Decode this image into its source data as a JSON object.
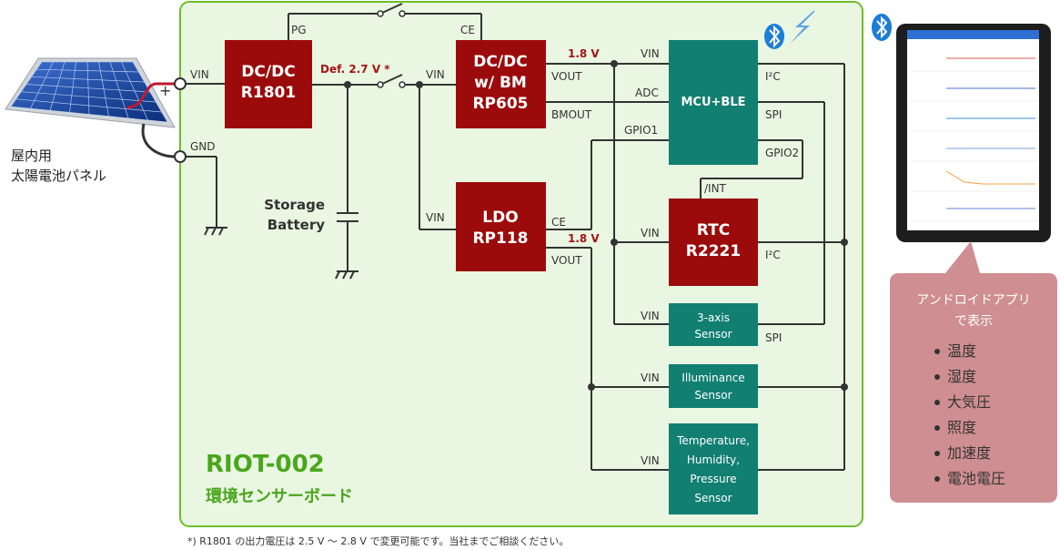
{
  "board": {
    "title": "RIOT-002",
    "subtitle": "環境センサーボード"
  },
  "panel": {
    "label_lines": [
      "屋内用",
      "太陽電池パネル"
    ],
    "plus": "+"
  },
  "chips": {
    "dcdc1": {
      "lines": [
        "DC/DC",
        "R1801"
      ]
    },
    "dcdc2": {
      "lines": [
        "DC/DC",
        "w/ BM",
        "RP605"
      ]
    },
    "ldo": {
      "lines": [
        "LDO",
        "RP118"
      ]
    },
    "mcu": {
      "lines": [
        "MCU+BLE"
      ]
    },
    "rtc": {
      "lines": [
        "RTC",
        "R2221"
      ]
    },
    "sensor3axis": {
      "lines": [
        "3-axis",
        "Sensor"
      ]
    },
    "illum": {
      "lines": [
        "Illuminance",
        "Sensor"
      ]
    },
    "thp": {
      "lines": [
        "Temperature,",
        "Humidity,",
        "Pressure",
        "Sensor"
      ]
    }
  },
  "pins": {
    "vin_main": "VIN",
    "gnd": "GND",
    "pg": "PG",
    "ce": "CE",
    "def_voltage": "Def. 2.7 V *",
    "vin": "VIN",
    "vout": "VOUT",
    "bmout": "BMOUT",
    "v18": "1.8 V",
    "adc": "ADC",
    "gpio1": "GPIO1",
    "gpio2": "GPIO2",
    "i2c": "I²C",
    "spi": "SPI",
    "int": "/INT"
  },
  "storage": {
    "lines": [
      "Storage",
      "Battery"
    ]
  },
  "android": {
    "lines": [
      "アンドロイドアプリ",
      "で表示"
    ],
    "items": [
      "温度",
      "湿度",
      "大気圧",
      "照度",
      "加速度",
      "電池電圧"
    ]
  },
  "footnote": "*) R1801 の出力電圧は 2.5 V ～ 2.8 V で変更可能です。当社までご相談ください。",
  "colors": {
    "board_fill": "#e9f6e2",
    "board_stroke": "#6bbf2a",
    "chip_red": "#9b0b0b",
    "sensor_teal": "#117f72",
    "callout_pink": "#cf8e91",
    "title_green": "#4aa61c",
    "bt_blue": "#1c7dd6"
  },
  "icons": [
    "bluetooth-icon",
    "wireless-signal-icon",
    "solar-panel-icon",
    "tablet-icon"
  ]
}
